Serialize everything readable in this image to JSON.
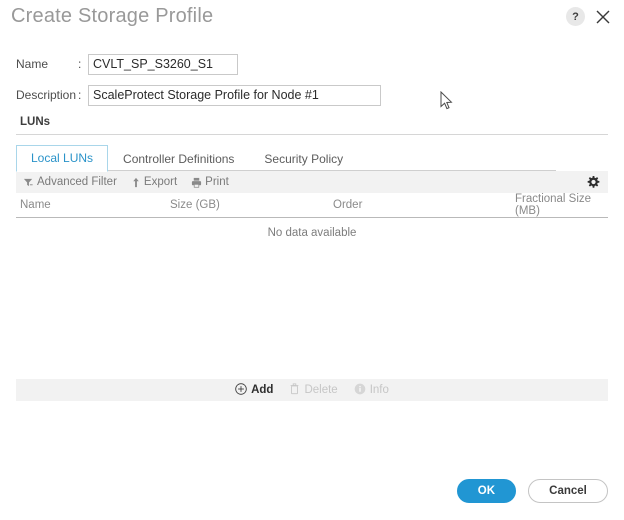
{
  "dialog": {
    "title": "Create Storage Profile",
    "help_icon": "?",
    "close_icon": "close-icon"
  },
  "form": {
    "name": {
      "label": "Name",
      "colon": ":",
      "value": "CVLT_SP_S3260_S1",
      "placeholder": ""
    },
    "description": {
      "label": "Description",
      "colon": ":",
      "value": "ScaleProtect Storage Profile for Node #1",
      "placeholder": ""
    },
    "section_label": "LUNs"
  },
  "tabs": [
    {
      "label": "Local LUNs",
      "active": true
    },
    {
      "label": "Controller Definitions",
      "active": false
    },
    {
      "label": "Security Policy",
      "active": false
    }
  ],
  "toolbar": {
    "advanced_filter": "Advanced Filter",
    "export": "Export",
    "print": "Print",
    "settings_icon": "gear-icon"
  },
  "table": {
    "columns": [
      "Name",
      "Size (GB)",
      "Order",
      "Fractional Size (MB)"
    ],
    "rows": [],
    "empty_message": "No data available"
  },
  "action_bar": [
    {
      "label": "Add",
      "enabled": true
    },
    {
      "label": "Delete",
      "enabled": false
    },
    {
      "label": "Info",
      "enabled": false
    }
  ],
  "footer": {
    "ok": "OK",
    "cancel": "Cancel"
  },
  "colors": {
    "accent": "#2196d3",
    "tab_active_text": "#2a93c9",
    "tab_active_border": "#a9d6ea",
    "toolbar_bg": "#f2f2f2",
    "title_text": "#999999"
  }
}
